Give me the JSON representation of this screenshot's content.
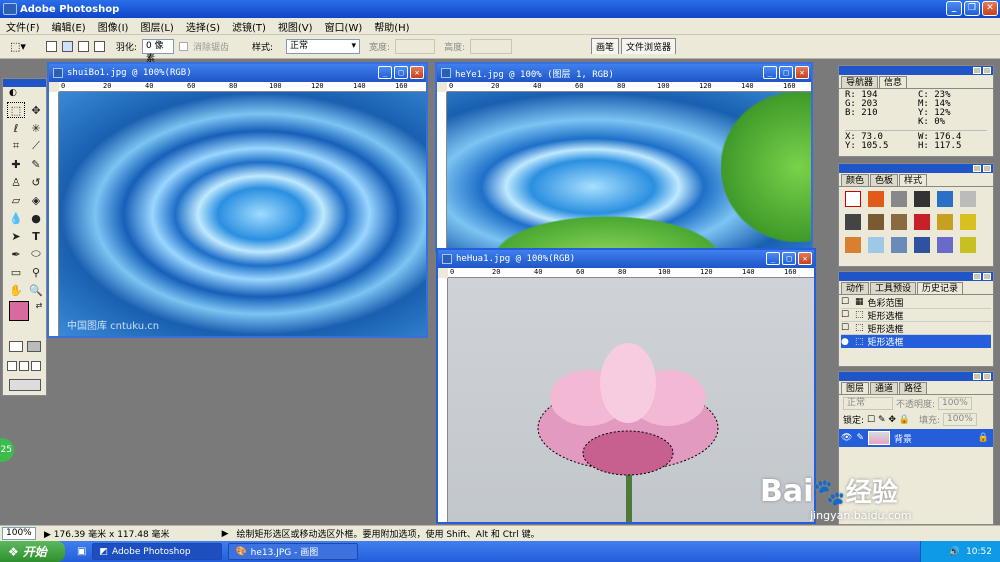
{
  "app": {
    "title": "Adobe Photoshop"
  },
  "menu": [
    "文件(F)",
    "编辑(E)",
    "图像(I)",
    "图层(L)",
    "选择(S)",
    "滤镜(T)",
    "视图(V)",
    "窗口(W)",
    "帮助(H)"
  ],
  "options": {
    "feather_label": "羽化:",
    "feather_value": "0 像素",
    "antialias_label": "消除锯齿",
    "style_label": "样式:",
    "style_value": "正常",
    "width_label": "宽度:",
    "height_label": "高度:",
    "well_tabs": [
      "画笔",
      "文件浏览器"
    ]
  },
  "documents": {
    "water": {
      "title": "shuiBo1.jpg @ 100%(RGB)",
      "watermark": "中国图库 cntuku.cn"
    },
    "leaf": {
      "title": "heYe1.jpg @ 100% (图层 1, RGB)"
    },
    "lotus": {
      "title": "heHua1.jpg @ 100%(RGB)"
    }
  },
  "ruler_ticks": [
    "0",
    "20",
    "40",
    "60",
    "80",
    "100",
    "120",
    "140",
    "160"
  ],
  "navigator": {
    "tabs": [
      "导航器",
      "信息"
    ],
    "R": "194",
    "G": "203",
    "B": "210",
    "C": "23%",
    "M": "14%",
    "Y": "12%",
    "K": "0%",
    "X": "73.0",
    "Yc": "105.5",
    "W": "176.4",
    "H": "117.5"
  },
  "swatches": {
    "tabs": [
      "颜色",
      "色板",
      "样式"
    ]
  },
  "history": {
    "tabs": [
      "动作",
      "工具预设",
      "历史记录"
    ],
    "items": [
      "色彩范围",
      "矩形选框",
      "矩形选框",
      "矩形选框"
    ]
  },
  "layers": {
    "tabs": [
      "图层",
      "通道",
      "路径"
    ],
    "blend": "正常",
    "opacity_label": "不透明度:",
    "opacity": "100%",
    "lock_label": "锁定:",
    "fill_label": "填充:",
    "fill": "100%",
    "layer_name": "背景"
  },
  "status": {
    "zoom": "100%",
    "doc_size": "176.39 毫米 x 117.48 毫米",
    "hint": "绘制矩形选区或移动选区外框。要用附加选项，使用 Shift、Alt 和 Ctrl 键。"
  },
  "taskbar": {
    "start": "开始",
    "tasks": [
      "Adobe Photoshop",
      "he13.JPG - 画图"
    ],
    "time": "10:52"
  },
  "badge": "25",
  "watermark": {
    "brand": "Bai",
    "brand2": "经验",
    "url": "jingyan.baidu.com"
  },
  "colors": {
    "fg": "#d86aa0",
    "bg": "#1a2a6a",
    "accent": "#1f55c6"
  }
}
